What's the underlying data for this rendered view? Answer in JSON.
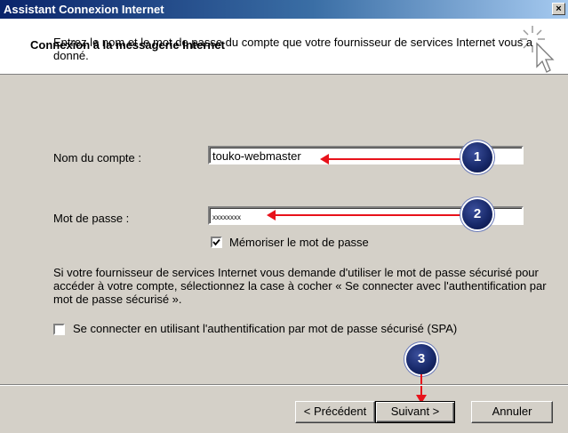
{
  "window": {
    "title": "Assistant Connexion Internet",
    "close_glyph": "×"
  },
  "header": {
    "title": "Connexion à la messagerie Internet",
    "icon": "wizard-wand-icon"
  },
  "form": {
    "intro": "Entrez le nom et le mot de passe du compte que votre fournisseur de services Internet vous a donné.",
    "account_label": "Nom du compte :",
    "account_value": "touko-webmaster",
    "password_label": "Mot de passe :",
    "password_value": "xxxxxxxx",
    "remember_label": "Mémoriser le mot de passe",
    "remember_checked": true,
    "spa_text": "Si votre fournisseur de services Internet vous demande d'utiliser le mot de passe sécurisé pour accéder à votre compte, sélectionnez la case à cocher « Se connecter avec l'authentification par mot de passe sécurisé ».",
    "spa_label": "Se connecter en utilisant l'authentification par mot de passe sécurisé (SPA)",
    "spa_checked": false
  },
  "annotations": {
    "badge1": "1",
    "badge2": "2",
    "badge3": "3",
    "arrow_color": "#e8121b"
  },
  "buttons": {
    "back": "< Précédent",
    "next": "Suivant >",
    "cancel": "Annuler"
  }
}
